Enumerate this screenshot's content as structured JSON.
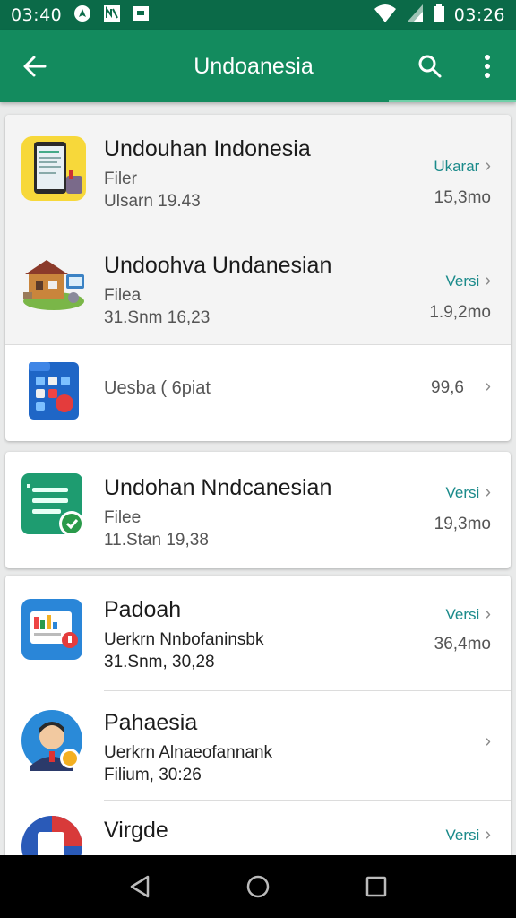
{
  "status_bar": {
    "time_left": "03:40",
    "time_right": "03:26",
    "icons": [
      "navigation-icon",
      "notification-icon",
      "image-icon",
      "wifi-icon",
      "signal-icon",
      "battery-icon"
    ]
  },
  "app_bar": {
    "title": "Undoanesia",
    "icons": [
      "back-arrow-icon",
      "search-icon",
      "more-vert-icon"
    ]
  },
  "lists": {
    "card1": [
      {
        "name": "Undouhan Indonesia",
        "line2": "Filer",
        "line3": "Ulsarn 19.43",
        "link": "Ukarar",
        "size": "15,3mo",
        "icon": "tablet-document-icon"
      },
      {
        "name": "Undoohva Undanesian",
        "line2": "Filea",
        "line3": "31.Snm 16,23",
        "link": "Versi",
        "size": "1.9,2mo",
        "icon": "house-illustration-icon"
      },
      {
        "name": "Uesba ( 6piat",
        "size": "99,6",
        "icon": "blue-apps-folder-icon"
      }
    ],
    "card2": [
      {
        "name": "Undohan Nndcanesian",
        "line2": "Filee",
        "line3": "11.Stan 19,38",
        "link": "Versi",
        "size": "19,3mo",
        "icon": "green-document-icon"
      }
    ],
    "card3": [
      {
        "name": "Padoah",
        "line2": "Uerkrn Nnbofaninsbk",
        "line3": "31.Snm, 30,28",
        "link": "Versi",
        "size": "36,4mo",
        "icon": "blue-chart-app-icon"
      },
      {
        "name": "Pahaesia",
        "line2": "Uerkrn Alnaeofannank",
        "line3": "Filium, 30:26",
        "icon": "avatar-boy-icon"
      },
      {
        "name": "Virgde",
        "link": "Versi",
        "icon": "red-blue-app-icon"
      }
    ]
  },
  "nav_bar": {
    "icons": [
      "back-triangle-icon",
      "home-circle-icon",
      "recents-square-icon"
    ]
  },
  "colors": {
    "status_bar": "#0b6a48",
    "app_bar": "#138b5e",
    "link": "#1a8a8a",
    "background": "#e9eaea"
  }
}
